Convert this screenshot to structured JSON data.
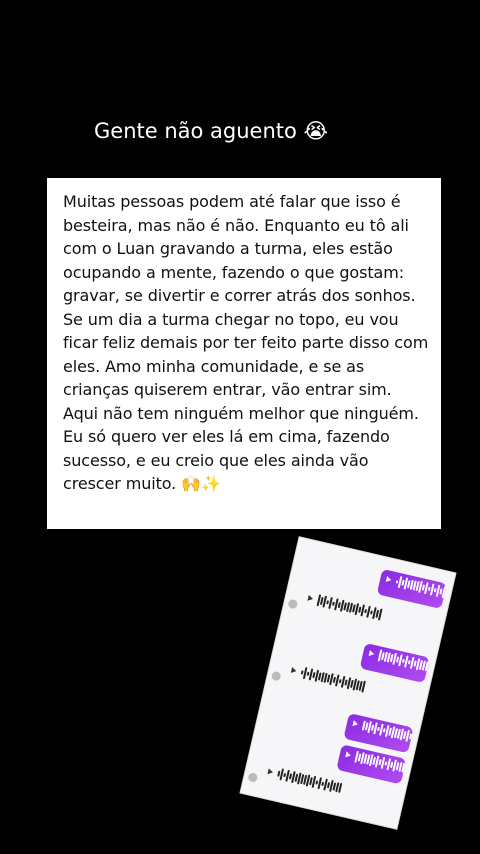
{
  "header": {
    "title": "Gente não aguento 😭"
  },
  "card": {
    "text": "Muitas pessoas podem até falar que isso é besteira, mas não é não. Enquanto eu tô ali com o Luan gravando a turma, eles estão ocupando a mente, fazendo o que gostam: gravar, se divertir e correr atrás dos sonhos. Se um dia a turma chegar no topo, eu vou ficar feliz demais por ter feito parte disso com eles. Amo minha comunidade, e se as crianças quiserem entrar, vão entrar sim. Aqui não tem ninguém melhor que ninguém.\nEu só quero ver eles lá em cima, fazendo sucesso, e eu creio que eles ainda vão crescer muito. 🙌✨"
  },
  "colors": {
    "background": "#000000",
    "card": "#ffffff",
    "outgoing_bubble": "#9b3fe8"
  },
  "chat_screenshot": {
    "messages": [
      {
        "direction": "out",
        "type": "voice-message"
      },
      {
        "direction": "in",
        "type": "voice-message"
      },
      {
        "direction": "out",
        "type": "voice-message"
      },
      {
        "direction": "in",
        "type": "voice-message"
      },
      {
        "direction": "out",
        "type": "voice-message"
      },
      {
        "direction": "out",
        "type": "voice-message"
      },
      {
        "direction": "in",
        "type": "voice-message"
      }
    ]
  }
}
